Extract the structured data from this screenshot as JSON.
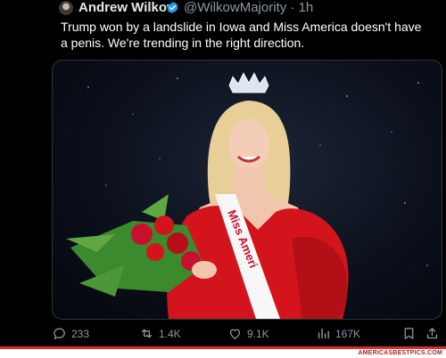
{
  "author": {
    "name": "Andrew Wilkow",
    "handle": "@WilkowMajority",
    "separator": "·",
    "time": "1h"
  },
  "tweet": {
    "text": "Trump won by a landslide in Iowa and Miss America doesn't have a penis. We're trending in the right direction."
  },
  "media": {
    "sash_text": "Miss Ameri"
  },
  "actions": {
    "replies": "233",
    "reposts": "1.4K",
    "likes": "9.1K",
    "views": "167K"
  },
  "footer": {
    "watermark": "AMERICASBESTPICS.COM"
  },
  "colors": {
    "background": "#000000",
    "muted": "#8b98a5",
    "verified": "#1d9bf0",
    "dress": "#d4141c",
    "watermark": "#b02424"
  }
}
